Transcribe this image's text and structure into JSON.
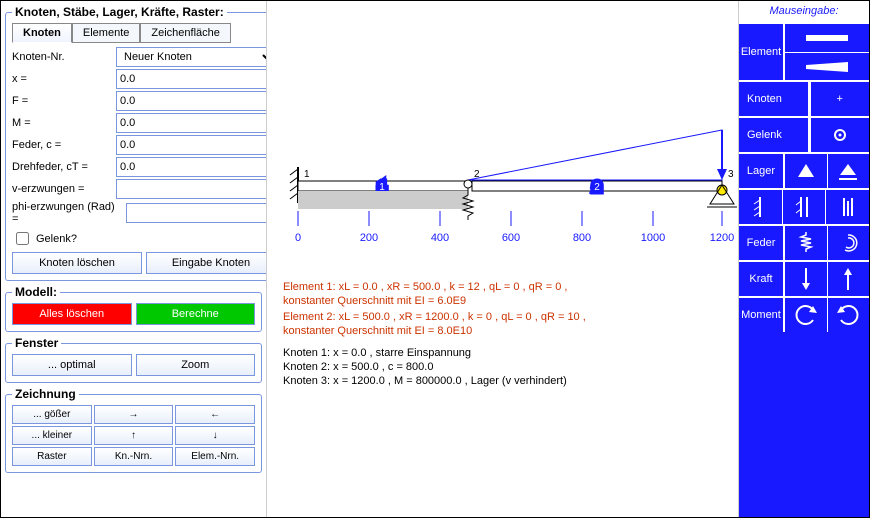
{
  "left": {
    "fieldset1_title": "Knoten, Stäbe, Lager, Kräfte, Raster:",
    "tabs": [
      "Knoten",
      "Elemente",
      "Zeichenfläche"
    ],
    "active_tab": 0,
    "knoten_nr_label": "Knoten-Nr.",
    "knoten_nr_value": "Neuer Knoten",
    "rows": [
      {
        "label": "x =",
        "value": "0.0"
      },
      {
        "label": "F =",
        "value": "0.0"
      },
      {
        "label": "M =",
        "value": "0.0"
      },
      {
        "label": "Feder, c =",
        "value": "0.0"
      },
      {
        "label": "Drehfeder, cT =",
        "value": "0.0"
      },
      {
        "label": "v-erzwungen =",
        "value": ""
      },
      {
        "label": "phi-erzwungen (Rad) =",
        "value": ""
      }
    ],
    "gelenk_label": "Gelenk?",
    "gelenk_checked": false,
    "btn_delete": "Knoten löschen",
    "btn_input": "Eingabe Knoten",
    "modell_title": "Modell:",
    "btn_clear_all": "Alles löschen",
    "btn_compute": "Berechne",
    "fenster_title": "Fenster",
    "btn_optimal": "... optimal",
    "btn_zoom": "Zoom",
    "zeichnung_title": "Zeichnung",
    "btn_bigger": "... gößer",
    "btn_arrow_r": "→",
    "btn_arrow_l": "←",
    "btn_smaller": "... kleiner",
    "btn_arrow_u": "↑",
    "btn_arrow_d": "↓",
    "btn_raster": "Raster",
    "btn_kn_nrn": "Kn.-Nrn.",
    "btn_elem_nrn": "Elem.-Nrn."
  },
  "canvas": {
    "axis_ticks": [
      "0",
      "200",
      "400",
      "600",
      "800",
      "1000",
      "1200"
    ],
    "elem1": "1",
    "elem2": "2",
    "node1": "1",
    "node2": "2",
    "node3": "3",
    "info1": "Element 1:   xL = 0.0 ,   xR = 500.0 ,   k = 12 ,   qL = 0 ,   qR = 0 ,",
    "info1b": "konstanter Querschnitt mit EI = 6.0E9",
    "info2": "Element 2:   xL = 500.0 ,   xR = 1200.0 ,   k = 0 ,   qL = 0 ,   qR = 10 ,",
    "info2b": "konstanter Querschnitt mit EI = 8.0E10",
    "k1": "Knoten 1:   x = 0.0 ,  starre Einspannung",
    "k2": "Knoten 2:   x = 500.0 ,   c = 800.0",
    "k3": "Knoten 3:   x = 1200.0 ,   M = 800000.0 ,   Lager (v verhindert)"
  },
  "right": {
    "header": "Mauseingabe:",
    "rows": [
      {
        "label": "Element",
        "icons": [
          "bar-straight-icon",
          "bar-tapered-icon"
        ],
        "stack": true
      },
      {
        "label": "Knoten",
        "icons": [
          "plus-icon"
        ]
      },
      {
        "label": "Gelenk",
        "icons": [
          "gear-icon"
        ]
      },
      {
        "label": "Lager",
        "icons": [
          "support-pin-icon",
          "support-roller-icon"
        ]
      },
      {
        "label": "",
        "icons": [
          "fixed-support-icon",
          "sliding-fixed-icon",
          "vertical-force-icon"
        ]
      },
      {
        "label": "Feder",
        "icons": [
          "spring-icon",
          "rot-spring-icon"
        ]
      },
      {
        "label": "Kraft",
        "icons": [
          "force-down-icon",
          "force-up-icon"
        ]
      },
      {
        "label": "Moment",
        "icons": [
          "moment-ccw-icon",
          "moment-cw-icon"
        ]
      }
    ]
  }
}
